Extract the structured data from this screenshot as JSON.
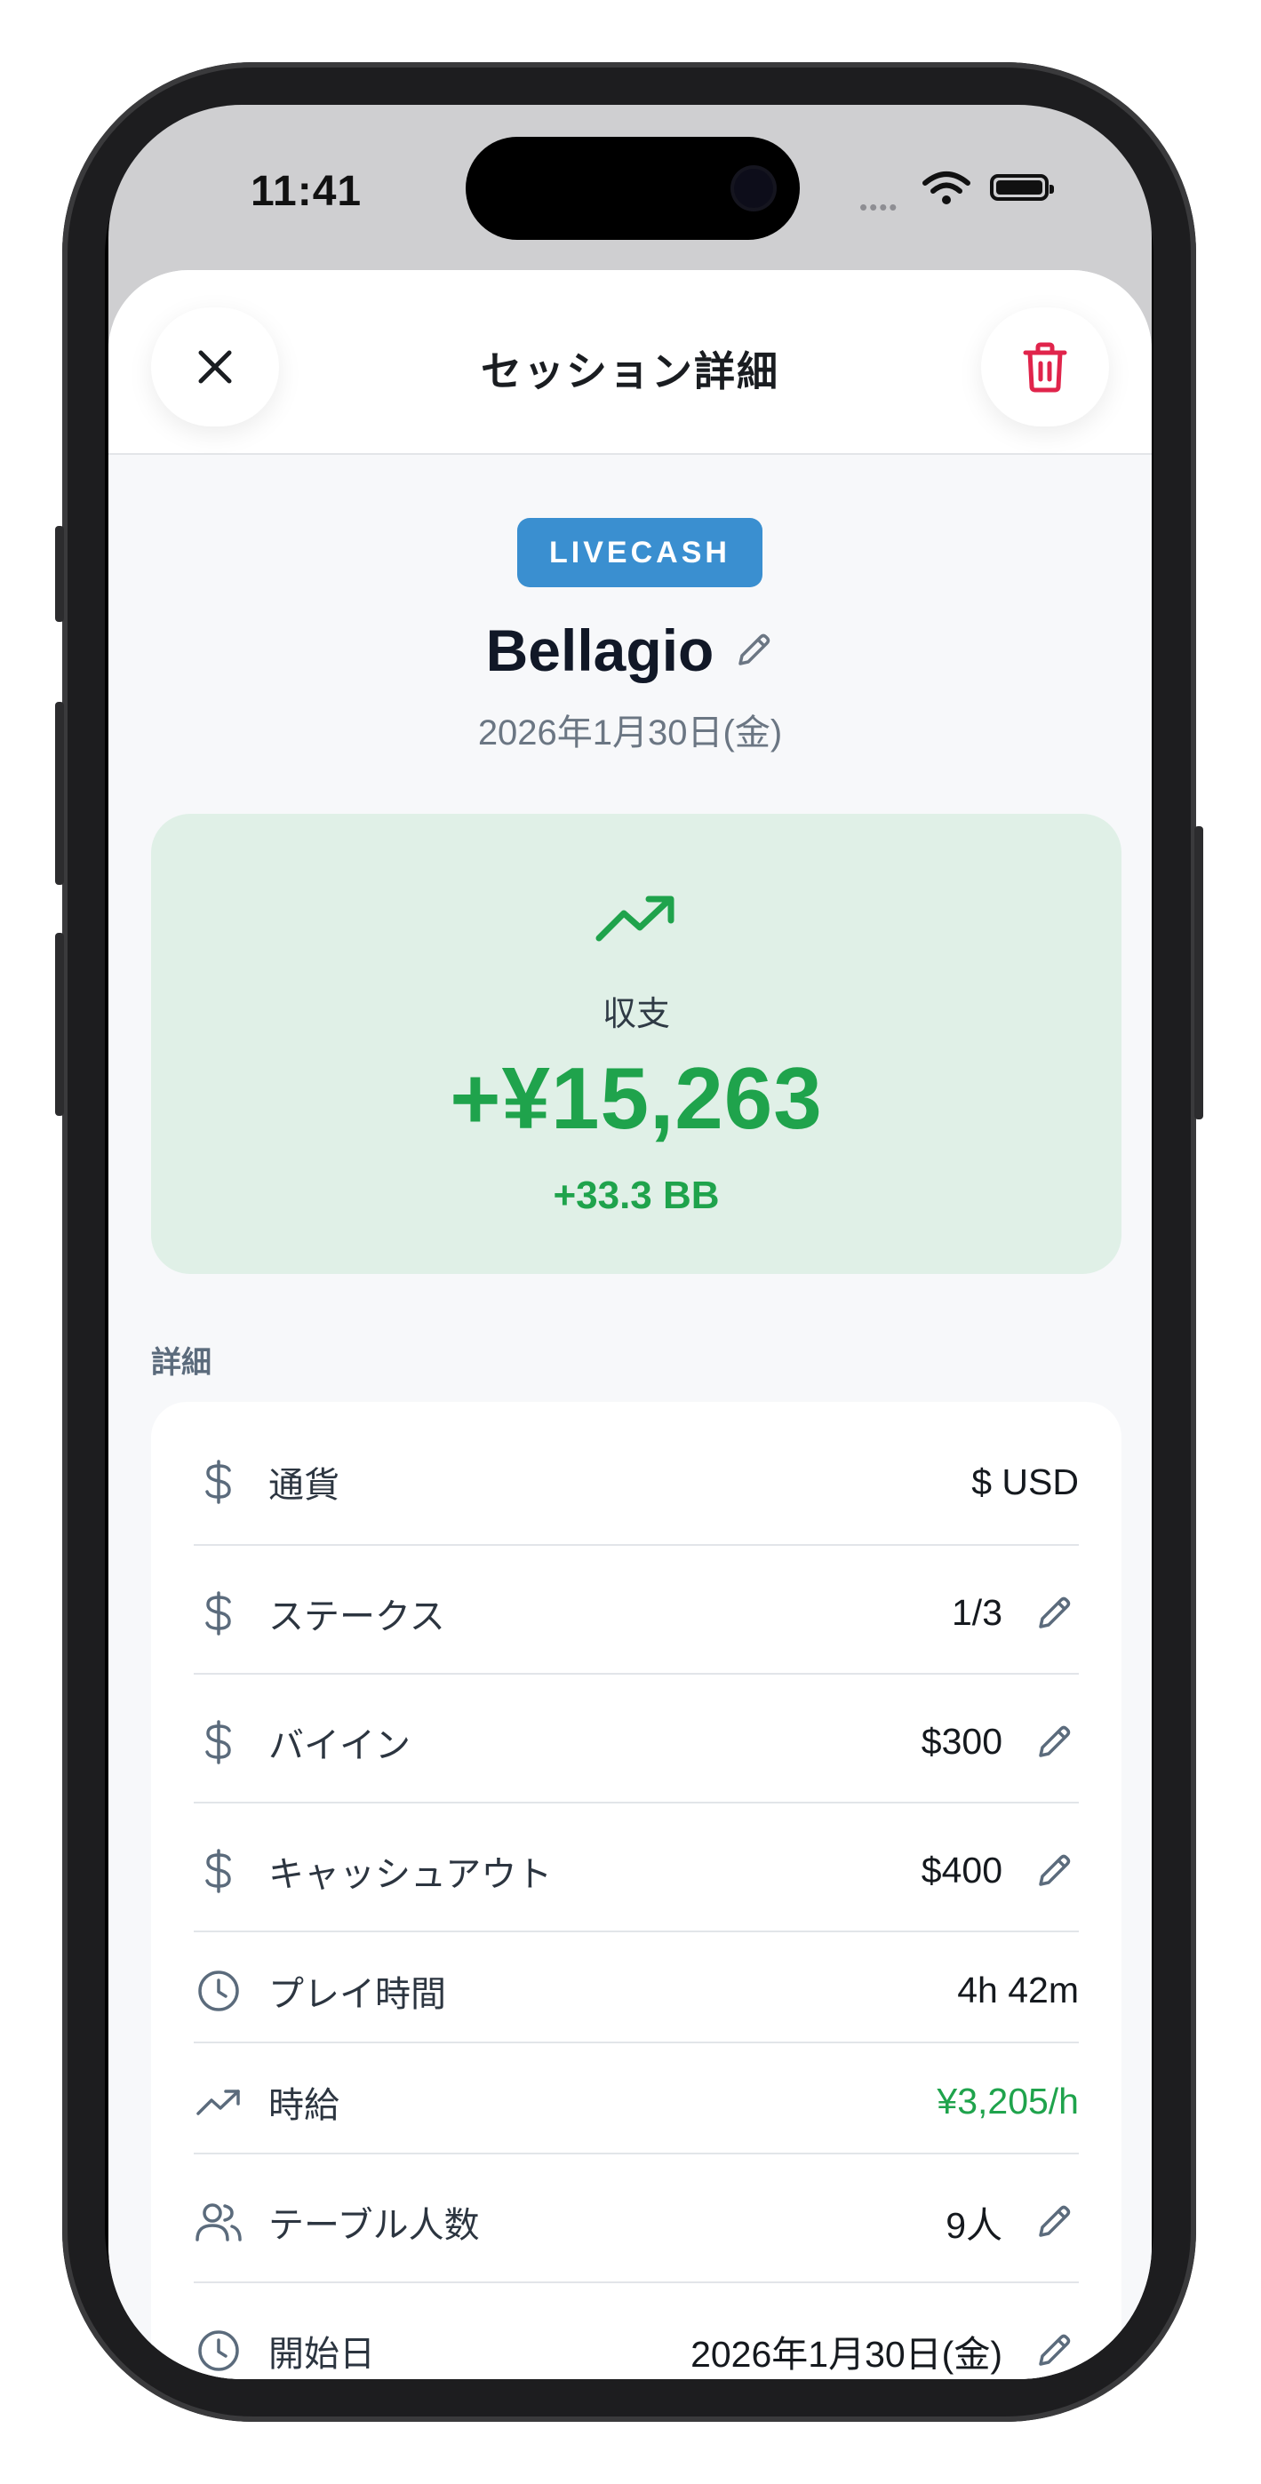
{
  "status_bar": {
    "time": "11:41",
    "signal": "••••"
  },
  "sheet": {
    "title": "セッション詳細",
    "close_icon": "close-icon",
    "delete_icon": "trash-icon"
  },
  "session": {
    "badge": "LIVECASH",
    "venue": "Bellagio",
    "date": "2026年1月30日(金)"
  },
  "result": {
    "label": "収支",
    "amount": "+¥15,263",
    "bb": "+33.3 BB",
    "color": "#1fa34c"
  },
  "details": {
    "section_label": "詳細",
    "rows": [
      {
        "icon": "dollar-icon",
        "label": "通貨",
        "value": "$ USD",
        "editable": false
      },
      {
        "icon": "dollar-icon",
        "label": "ステークス",
        "value": "1/3",
        "editable": true
      },
      {
        "icon": "dollar-icon",
        "label": "バイイン",
        "value": "$300",
        "editable": true
      },
      {
        "icon": "dollar-icon",
        "label": "キャッシュアウト",
        "value": "$400",
        "editable": true
      },
      {
        "icon": "clock-icon",
        "label": "プレイ時間",
        "value": "4h 42m",
        "editable": false
      },
      {
        "icon": "trend-up-icon",
        "label": "時給",
        "value": "¥3,205/h",
        "editable": false
      },
      {
        "icon": "users-icon",
        "label": "テーブル人数",
        "value": "9人",
        "editable": true
      },
      {
        "icon": "clock-icon",
        "label": "開始日",
        "value": "2026年1月30日(金)",
        "editable": true
      }
    ]
  }
}
